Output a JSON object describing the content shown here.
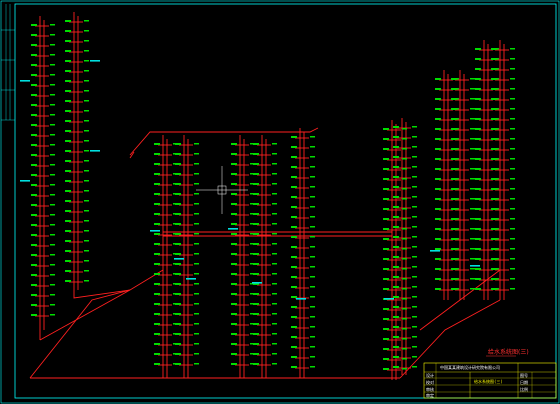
{
  "drawing": {
    "sheet_title": "给水系统图(三)",
    "title_block": {
      "project_line": "中国某某建筑设计研究院有限公司",
      "drawing_name": "给水系统图(三)",
      "rows": [
        "设计",
        "校对",
        "审核",
        "审定"
      ],
      "right_rows": [
        "图号",
        "日期",
        "比例"
      ]
    },
    "colors": {
      "background": "#000000",
      "pipe": "#ff0000",
      "fixture": "#00ff00",
      "label": "#00ffff",
      "frame": "#00ffff",
      "titleblock": "#ffff00"
    }
  }
}
